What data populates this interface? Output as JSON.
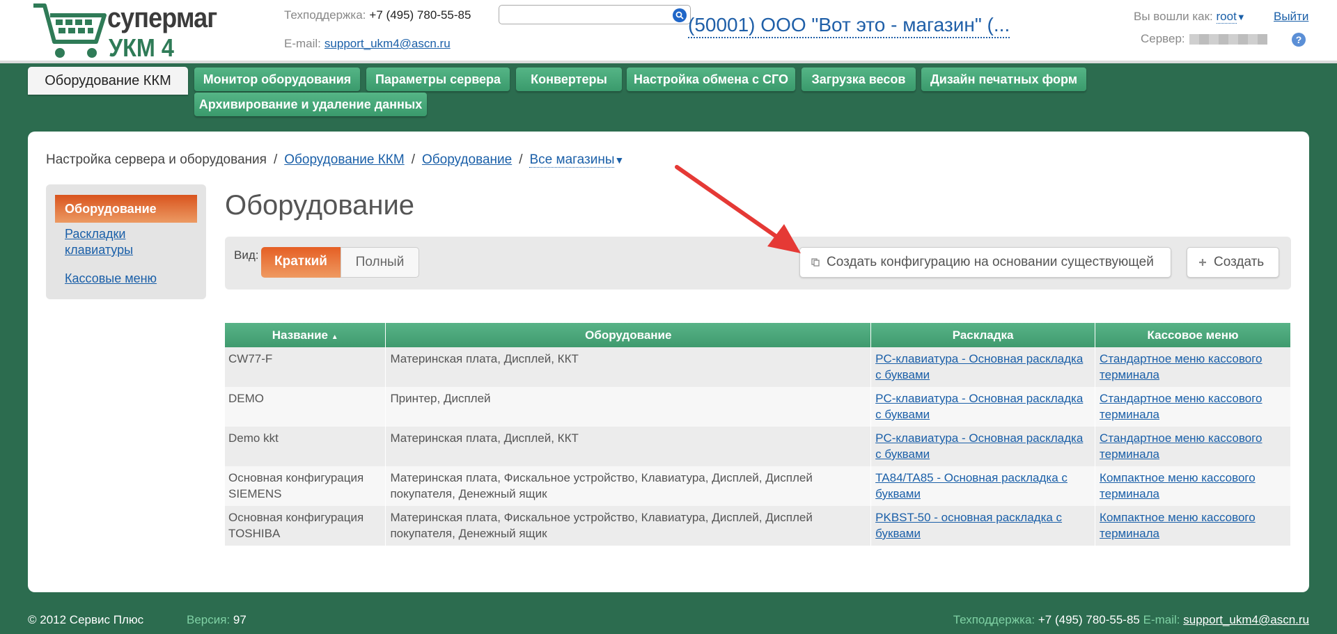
{
  "header": {
    "logo": {
      "line1": "супермаг",
      "line2": "УКМ 4"
    },
    "support_label": "Техподдержка:",
    "support_phone": "+7 (495) 780-55-85",
    "email_label": "E-mail:",
    "email": "support_ukm4@ascn.ru",
    "search_placeholder": "",
    "store": "(50001) ООО \"Вот это - магазин\" (...",
    "login_label": "Вы вошли как:",
    "user": "root",
    "logout": "Выйти",
    "server_label": "Сервер:"
  },
  "tabs": {
    "active": "Оборудование ККМ",
    "items": [
      "Монитор оборудования",
      "Параметры сервера",
      "Конвертеры",
      "Настройка обмена с СГО",
      "Загрузка весов",
      "Дизайн печатных форм",
      "Архивирование и удаление данных"
    ]
  },
  "breadcrumb": {
    "root": "Настройка сервера и оборудования",
    "sep": "/",
    "crumb1": "Оборудование ККМ",
    "crumb2": "Оборудование",
    "crumb3": "Все магазины"
  },
  "sidenav": {
    "active": "Оборудование",
    "items": [
      "Раскладки клавиатуры",
      "Кассовые меню"
    ]
  },
  "page_title": "Оборудование",
  "toolbar": {
    "view_label": "Вид:",
    "view_short": "Краткий",
    "view_full": "Полный",
    "copy_button": "Создать конфигурацию на основании существующей",
    "create_button": "Создать"
  },
  "table": {
    "columns": [
      "Название",
      "Оборудование",
      "Раскладка",
      "Кассовое меню"
    ],
    "rows": [
      [
        "CW77-F",
        "Материнская плата, Дисплей, ККТ",
        "PC-клавиатура - Основная раскладка с буквами",
        "Стандартное меню кассового терминала"
      ],
      [
        "DEMO",
        "Принтер, Дисплей",
        "PC-клавиатура - Основная раскладка с буквами",
        "Стандартное меню кассового терминала"
      ],
      [
        "Demo kkt",
        "Материнская плата, Дисплей, ККТ",
        "PC-клавиатура - Основная раскладка с буквами",
        "Стандартное меню кассового терминала"
      ],
      [
        "Основная конфигурация SIEMENS",
        "Материнская плата, Фискальное устройство, Клавиатура, Дисплей, Дисплей покупателя, Денежный ящик",
        "TA84/TA85 - Основная раскладка с буквами",
        "Компактное меню кассового терминала"
      ],
      [
        "Основная конфигурация TOSHIBA",
        "Материнская плата, Фискальное устройство, Клавиатура, Дисплей, Дисплей покупателя, Денежный ящик",
        "PKBST-50 - основная раскладка с буквами",
        "Компактное меню кассового терминала"
      ]
    ]
  },
  "footer": {
    "copyright": "© 2012 Сервис Плюс",
    "version_label": "Версия:",
    "version": "97",
    "support_label": "Техподдержка:",
    "support_phone": "+7 (495) 780-55-85",
    "email_label": "E-mail:",
    "email": "support_ukm4@ascn.ru"
  },
  "colors": {
    "background": "#2c6c4f",
    "tab_green": "#3f9a6e",
    "active_orange": "#e55f24",
    "link": "#1a5fa8",
    "annotation_arrow": "#e53935"
  }
}
